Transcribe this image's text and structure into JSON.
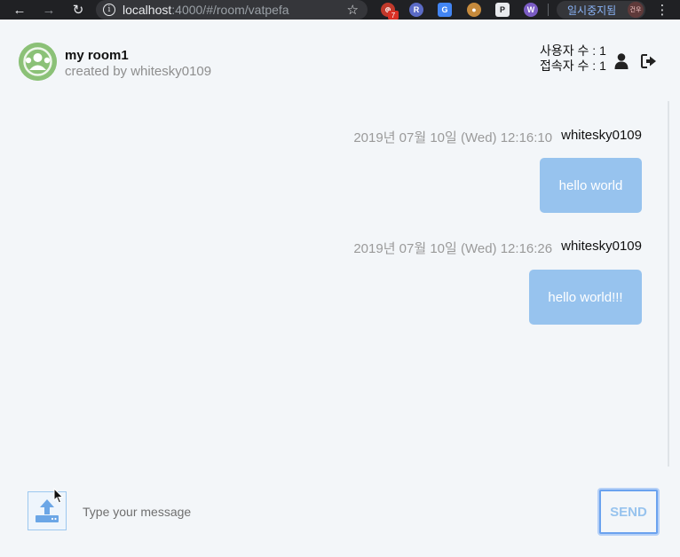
{
  "browser": {
    "url_host": "localhost",
    "url_path": ":4000/#/room/vatpefa",
    "extension_badge": "7",
    "profile_status": "일시중지됨",
    "profile_initials": "건우"
  },
  "room": {
    "title": "my room1",
    "creator": "created by whitesky0109",
    "user_count_label": "사용자 수 : 1",
    "connected_count_label": "접속자 수 : 1"
  },
  "messages": [
    {
      "time": "2019년 07월 10일 (Wed) 12:16:10",
      "user": "whitesky0109",
      "text": "hello world"
    },
    {
      "time": "2019년 07월 10일 (Wed) 12:16:26",
      "user": "whitesky0109",
      "text": "hello world!!!"
    }
  ],
  "composer": {
    "placeholder": "Type your message",
    "send_label": "SEND"
  },
  "colors": {
    "accent": "#97c3ee",
    "avatar": "#8bc177",
    "background": "#f3f6f9"
  }
}
